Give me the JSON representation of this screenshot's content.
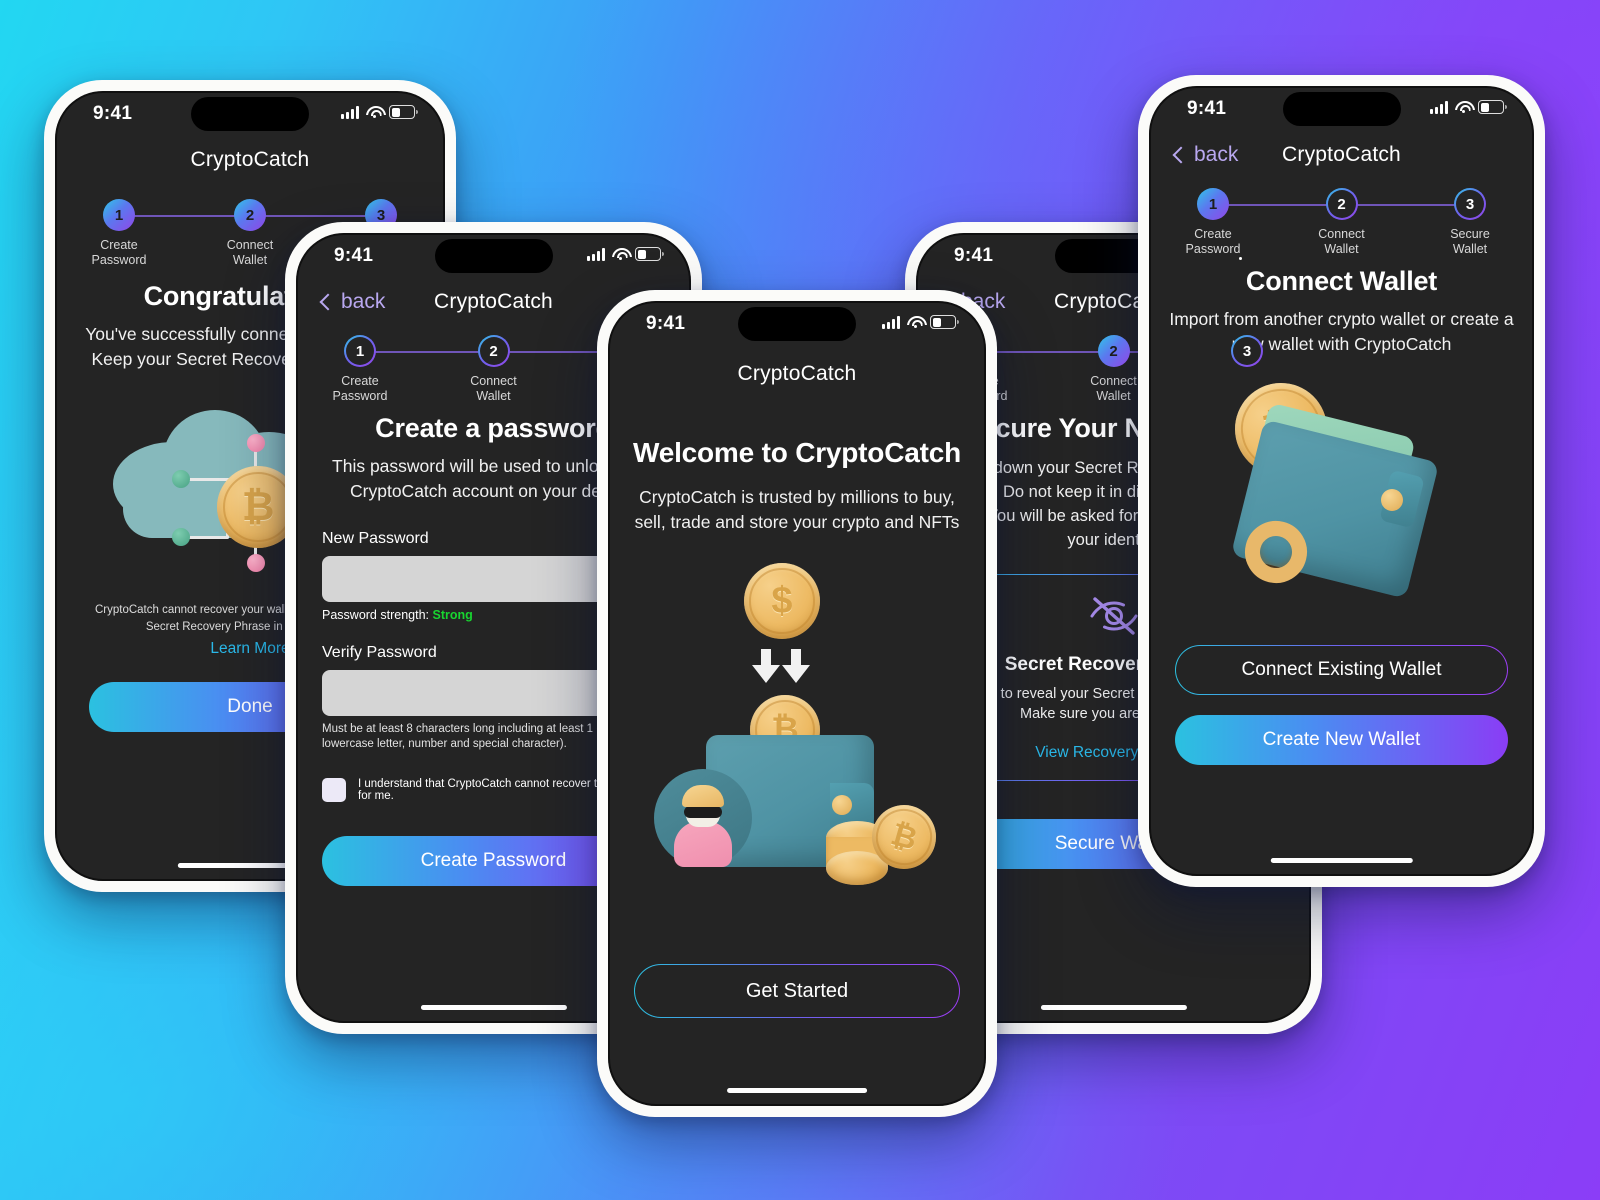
{
  "background": {
    "from": "#22D7F2",
    "to": "#8B3DF7"
  },
  "app": {
    "name": "CryptoCatch",
    "status_time": "9:41",
    "back_label": "back"
  },
  "steps": [
    {
      "num": "1",
      "line1": "Create",
      "line2": "Password"
    },
    {
      "num": "2",
      "line1": "Connect",
      "line2": "Wallet"
    },
    {
      "num": "3",
      "line1": "Secure",
      "line2": "Wallet"
    }
  ],
  "screens": {
    "congrats": {
      "title": "Congratulations!",
      "subtitle": "You've successfully connected your wallet. Keep your Secret Recovery Phrase safe.",
      "fineprint": "CryptoCatch cannot recover your wallet should you lose your Secret Recovery Phrase in your settings.",
      "learn_more": "Learn More",
      "primary_button": "Done"
    },
    "create_password": {
      "title": "Create a password",
      "subtitle": "This password will be used to unlock your CryptoCatch account on your device.",
      "new_password_label": "New Password",
      "new_password_value": "",
      "new_password_placeholder": "",
      "strength_label": "Password strength:",
      "strength_value": "Strong",
      "verify_password_label": "Verify Password",
      "verify_password_value": "",
      "verify_password_placeholder": "",
      "requirements": "Must be at least 8 characters long including at least 1 (capital letter, lowercase letter, number and special character).",
      "consent": "I understand that CryptoCatch cannot recover this password for me.",
      "primary_button": "Create Password"
    },
    "welcome": {
      "title": "Welcome to CryptoCatch",
      "subtitle": "CryptoCatch is trusted by millions to buy, sell, trade and store your crypto and NFTs",
      "primary_button": "Get Started"
    },
    "secure_wallet": {
      "title": "Secure Your New Wallet",
      "subtitle": "Write down your Secret Recovery Phrase on paper. Do not keep it in digital form in a safe place. You will be asked for this Phrase to verify your identity.",
      "card_title": "Secret Recovery Phrase",
      "card_text": "Tap to reveal your Secret Recovery Phrase. Make sure you are in private.",
      "card_link": "View Recovery Phrase",
      "primary_button": "Secure Wallet"
    },
    "connect_wallet": {
      "title": "Connect Wallet",
      "subtitle": "Import from another crypto wallet or create a new wallet with CryptoCatch",
      "secondary_button": "Connect Existing Wallet",
      "primary_button": "Create New Wallet"
    }
  }
}
